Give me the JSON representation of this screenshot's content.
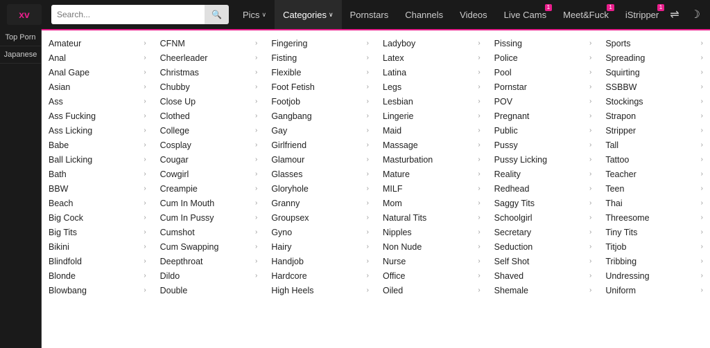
{
  "navbar": {
    "logo_text": "xv",
    "search_placeholder": "Search...",
    "nav_links": [
      {
        "label": "Pics",
        "id": "pics",
        "has_arrow": true,
        "badge": null
      },
      {
        "label": "Categories",
        "id": "categories",
        "has_arrow": true,
        "badge": null,
        "active": true
      },
      {
        "label": "Pornstars",
        "id": "pornstars",
        "has_arrow": false,
        "badge": null
      },
      {
        "label": "Channels",
        "id": "channels",
        "has_arrow": false,
        "badge": null
      },
      {
        "label": "Videos",
        "id": "videos",
        "has_arrow": false,
        "badge": null
      },
      {
        "label": "Live Cams",
        "id": "live-cams",
        "has_arrow": false,
        "badge": "1"
      },
      {
        "label": "Meet&Fuck",
        "id": "meet-fuck",
        "has_arrow": false,
        "badge": "1"
      },
      {
        "label": "iStripper",
        "id": "istripper",
        "has_arrow": false,
        "badge": "1"
      }
    ],
    "icon_shuffle": "⇌",
    "icon_moon": "☽"
  },
  "sidebar": {
    "items": [
      {
        "label": "Top Porn",
        "id": "top-porn"
      },
      {
        "label": "Japanese",
        "id": "japanese"
      }
    ]
  },
  "categories": {
    "columns": [
      [
        {
          "label": "Amateur",
          "has_arrow": true
        },
        {
          "label": "Anal",
          "has_arrow": true
        },
        {
          "label": "Anal Gape",
          "has_arrow": true
        },
        {
          "label": "Asian",
          "has_arrow": true
        },
        {
          "label": "Ass",
          "has_arrow": true
        },
        {
          "label": "Ass Fucking",
          "has_arrow": true
        },
        {
          "label": "Ass Licking",
          "has_arrow": true
        },
        {
          "label": "Babe",
          "has_arrow": true
        },
        {
          "label": "Ball Licking",
          "has_arrow": true
        },
        {
          "label": "Bath",
          "has_arrow": true
        },
        {
          "label": "BBW",
          "has_arrow": true
        },
        {
          "label": "Beach",
          "has_arrow": true
        },
        {
          "label": "Big Cock",
          "has_arrow": true
        },
        {
          "label": "Big Tits",
          "has_arrow": true
        },
        {
          "label": "Bikini",
          "has_arrow": true
        },
        {
          "label": "Blindfold",
          "has_arrow": true
        },
        {
          "label": "Blonde",
          "has_arrow": true
        },
        {
          "label": "Blowbang",
          "has_arrow": true
        }
      ],
      [
        {
          "label": "CFNM",
          "has_arrow": true
        },
        {
          "label": "Cheerleader",
          "has_arrow": true
        },
        {
          "label": "Christmas",
          "has_arrow": true
        },
        {
          "label": "Chubby",
          "has_arrow": true
        },
        {
          "label": "Close Up",
          "has_arrow": true
        },
        {
          "label": "Clothed",
          "has_arrow": true
        },
        {
          "label": "College",
          "has_arrow": true
        },
        {
          "label": "Cosplay",
          "has_arrow": true
        },
        {
          "label": "Cougar",
          "has_arrow": true
        },
        {
          "label": "Cowgirl",
          "has_arrow": true
        },
        {
          "label": "Creampie",
          "has_arrow": true
        },
        {
          "label": "Cum In Mouth",
          "has_arrow": true
        },
        {
          "label": "Cum In Pussy",
          "has_arrow": true
        },
        {
          "label": "Cumshot",
          "has_arrow": true
        },
        {
          "label": "Cum Swapping",
          "has_arrow": true
        },
        {
          "label": "Deepthroat",
          "has_arrow": true
        },
        {
          "label": "Dildo",
          "has_arrow": true
        },
        {
          "label": "Double",
          "has_arrow": false
        }
      ],
      [
        {
          "label": "Fingering",
          "has_arrow": true
        },
        {
          "label": "Fisting",
          "has_arrow": true
        },
        {
          "label": "Flexible",
          "has_arrow": true
        },
        {
          "label": "Foot Fetish",
          "has_arrow": true
        },
        {
          "label": "Footjob",
          "has_arrow": true
        },
        {
          "label": "Gangbang",
          "has_arrow": true
        },
        {
          "label": "Gay",
          "has_arrow": true
        },
        {
          "label": "Girlfriend",
          "has_arrow": true
        },
        {
          "label": "Glamour",
          "has_arrow": true
        },
        {
          "label": "Glasses",
          "has_arrow": true
        },
        {
          "label": "Gloryhole",
          "has_arrow": true
        },
        {
          "label": "Granny",
          "has_arrow": true
        },
        {
          "label": "Groupsex",
          "has_arrow": true
        },
        {
          "label": "Gyno",
          "has_arrow": true
        },
        {
          "label": "Hairy",
          "has_arrow": true
        },
        {
          "label": "Handjob",
          "has_arrow": true
        },
        {
          "label": "Hardcore",
          "has_arrow": true
        },
        {
          "label": "High Heels",
          "has_arrow": true
        }
      ],
      [
        {
          "label": "Ladyboy",
          "has_arrow": true
        },
        {
          "label": "Latex",
          "has_arrow": true
        },
        {
          "label": "Latina",
          "has_arrow": true
        },
        {
          "label": "Legs",
          "has_arrow": true
        },
        {
          "label": "Lesbian",
          "has_arrow": true
        },
        {
          "label": "Lingerie",
          "has_arrow": true
        },
        {
          "label": "Maid",
          "has_arrow": true
        },
        {
          "label": "Massage",
          "has_arrow": true
        },
        {
          "label": "Masturbation",
          "has_arrow": true
        },
        {
          "label": "Mature",
          "has_arrow": true
        },
        {
          "label": "MILF",
          "has_arrow": true
        },
        {
          "label": "Mom",
          "has_arrow": true
        },
        {
          "label": "Natural Tits",
          "has_arrow": true
        },
        {
          "label": "Nipples",
          "has_arrow": true
        },
        {
          "label": "Non Nude",
          "has_arrow": true
        },
        {
          "label": "Nurse",
          "has_arrow": true
        },
        {
          "label": "Office",
          "has_arrow": true
        },
        {
          "label": "Oiled",
          "has_arrow": true
        }
      ],
      [
        {
          "label": "Pissing",
          "has_arrow": true
        },
        {
          "label": "Police",
          "has_arrow": true
        },
        {
          "label": "Pool",
          "has_arrow": true
        },
        {
          "label": "Pornstar",
          "has_arrow": true
        },
        {
          "label": "POV",
          "has_arrow": true
        },
        {
          "label": "Pregnant",
          "has_arrow": true
        },
        {
          "label": "Public",
          "has_arrow": true
        },
        {
          "label": "Pussy",
          "has_arrow": true
        },
        {
          "label": "Pussy Licking",
          "has_arrow": true
        },
        {
          "label": "Reality",
          "has_arrow": true
        },
        {
          "label": "Redhead",
          "has_arrow": true
        },
        {
          "label": "Saggy Tits",
          "has_arrow": true
        },
        {
          "label": "Schoolgirl",
          "has_arrow": true
        },
        {
          "label": "Secretary",
          "has_arrow": true
        },
        {
          "label": "Seduction",
          "has_arrow": true
        },
        {
          "label": "Self Shot",
          "has_arrow": true
        },
        {
          "label": "Shaved",
          "has_arrow": true
        },
        {
          "label": "Shemale",
          "has_arrow": true
        }
      ],
      [
        {
          "label": "Sports",
          "has_arrow": true
        },
        {
          "label": "Spreading",
          "has_arrow": true
        },
        {
          "label": "Squirting",
          "has_arrow": true
        },
        {
          "label": "SSBBW",
          "has_arrow": true
        },
        {
          "label": "Stockings",
          "has_arrow": true
        },
        {
          "label": "Strapon",
          "has_arrow": true
        },
        {
          "label": "Stripper",
          "has_arrow": true
        },
        {
          "label": "Tall",
          "has_arrow": true
        },
        {
          "label": "Tattoo",
          "has_arrow": true
        },
        {
          "label": "Teacher",
          "has_arrow": true
        },
        {
          "label": "Teen",
          "has_arrow": true
        },
        {
          "label": "Thai",
          "has_arrow": true
        },
        {
          "label": "Threesome",
          "has_arrow": true
        },
        {
          "label": "Tiny Tits",
          "has_arrow": true
        },
        {
          "label": "Titjob",
          "has_arrow": true
        },
        {
          "label": "Tribbing",
          "has_arrow": true
        },
        {
          "label": "Undressing",
          "has_arrow": true
        },
        {
          "label": "Uniform",
          "has_arrow": true
        }
      ]
    ]
  }
}
